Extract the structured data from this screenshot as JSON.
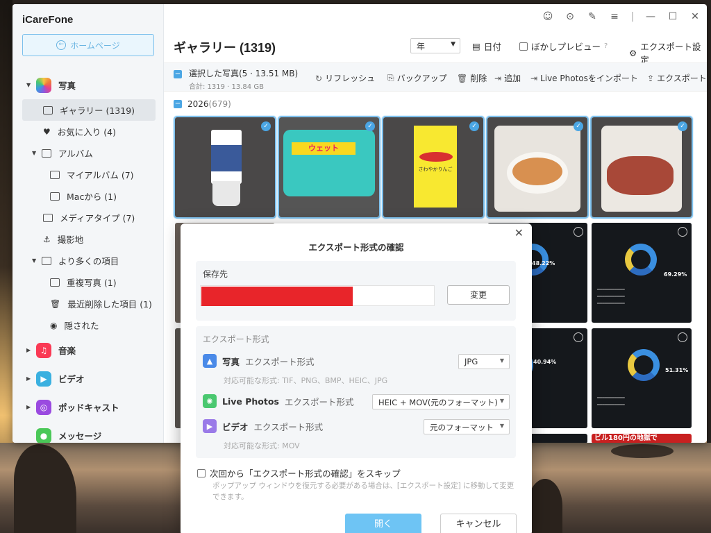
{
  "app": {
    "title": "iCareFone",
    "home_label": "ホームページ"
  },
  "sidebar": {
    "photos_label": "写真",
    "gallery_label": "ギャラリー (1319)",
    "favorites_label": "お気に入り (4)",
    "album_label": "アルバム",
    "my_album_label": "マイアルバム (7)",
    "mac_label": "Macから (1)",
    "media_type_label": "メディアタイプ (7)",
    "location_label": "撮影地",
    "more_label": "より多くの項目",
    "duplicates_label": "重複写真 (1)",
    "recently_deleted_label": "最近削除した項目 (1)",
    "hidden_label": "隠された",
    "music_label": "音楽",
    "video_label": "ビデオ",
    "podcast_label": "ポッドキャスト",
    "messages_label": "メッセージ"
  },
  "header": {
    "title": "ギャラリー (1319)",
    "year_select": "年",
    "date_label": "日付",
    "blur_preview_label": "ぼかしプレビュー",
    "export_settings_label": "エクスポート設定"
  },
  "toolbar": {
    "selected_label": "選択した写真(5 · 13.51 MB)",
    "total_label": "合計: 1319 · 13.84 GB",
    "refresh_label": "リフレッシュ",
    "backup_label": "バックアップ",
    "delete_label": "削除",
    "add_label": "追加",
    "import_live_label": "Live Photosをインポート",
    "export_label": "エクスポート"
  },
  "section": {
    "year": "2026",
    "count": "(679)"
  },
  "thumb_texts": {
    "wet_label": "ウェット",
    "apple_label": "さわやかりんご",
    "pct_1": "48.22%",
    "pct_2": "69.29%",
    "pct_3": "40.94%",
    "pct_4": "51.31%",
    "banner": "ビル180円の地獄で"
  },
  "modal": {
    "title": "エクスポート形式の確認",
    "save_to_label": "保存先",
    "change_label": "変更",
    "format_header": "エクスポート形式",
    "photo_name": "写真",
    "photo_sub": "エクスポート形式",
    "photo_value": "JPG",
    "photo_hint": "対応可能な形式: TIF、PNG、BMP、HEIC、JPG",
    "live_name": "Live Photos",
    "live_sub": "エクスポート形式",
    "live_value": "HEIC + MOV(元のフォーマット)",
    "video_name": "ビデオ",
    "video_sub": "エクスポート形式",
    "video_value": "元のフォーマット",
    "video_hint": "対応可能な形式: MOV",
    "skip_label": "次回から「エクスポート形式の確認」をスキップ",
    "skip_hint": "ポップアップ ウィンドウを復元する必要がある場合は、[エクスポート設定] に移動して変更できます。",
    "ok_label": "開く",
    "cancel_label": "キャンセル"
  },
  "colors": {
    "accent": "#4ba6e4",
    "redact": "#e8252a",
    "ok_button": "#6ec4f4"
  }
}
